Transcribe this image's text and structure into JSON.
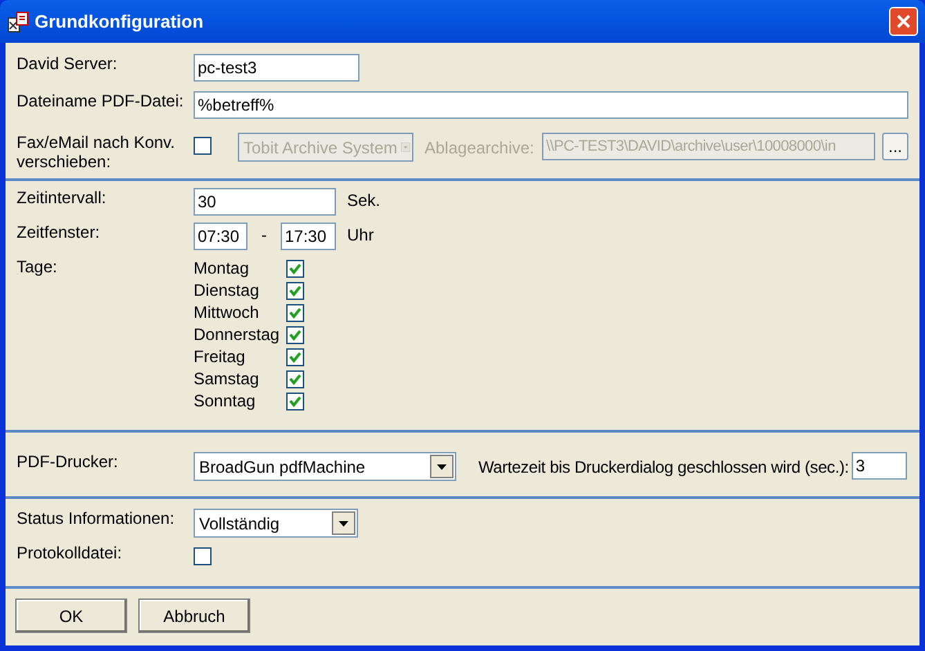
{
  "window": {
    "title": "Grundkonfiguration"
  },
  "general": {
    "server": {
      "label": "David Server:",
      "value": "pc-test3"
    },
    "filename": {
      "label": "Dateiname PDF-Datei:",
      "value": "%betreff%"
    },
    "move": {
      "label": "Fax/eMail nach Konv. verschieben:",
      "checked": false,
      "archive_system": {
        "value": "Tobit Archive System",
        "disabled": true
      },
      "archive_label": "Ablagearchive:",
      "archive_path": {
        "value": "\\\\PC-TEST3\\DAVID\\archive\\user\\10008000\\in",
        "disabled": true
      },
      "browse_button": "..."
    }
  },
  "schedule": {
    "interval": {
      "label": "Zeitintervall:",
      "value": "30",
      "unit": "Sek."
    },
    "window": {
      "label": "Zeitfenster:",
      "from": "07:30",
      "separator": "-",
      "to": "17:30",
      "unit": "Uhr"
    },
    "days_label": "Tage:",
    "days": [
      {
        "name": "Montag",
        "checked": true
      },
      {
        "name": "Dienstag",
        "checked": true
      },
      {
        "name": "Mittwoch",
        "checked": true
      },
      {
        "name": "Donnerstag",
        "checked": true
      },
      {
        "name": "Freitag",
        "checked": true
      },
      {
        "name": "Samstag",
        "checked": true
      },
      {
        "name": "Sonntag",
        "checked": true
      }
    ]
  },
  "printer": {
    "label": "PDF-Drucker:",
    "value": "BroadGun pdfMachine",
    "wait_label": "Wartezeit bis Druckerdialog geschlossen wird (sec.):",
    "wait_value": "3"
  },
  "logging": {
    "status": {
      "label": "Status Informationen:",
      "value": "Vollständig"
    },
    "logfile": {
      "label": "Protokolldatei:",
      "checked": false
    }
  },
  "buttons": [
    "OK",
    "Abbruch"
  ]
}
